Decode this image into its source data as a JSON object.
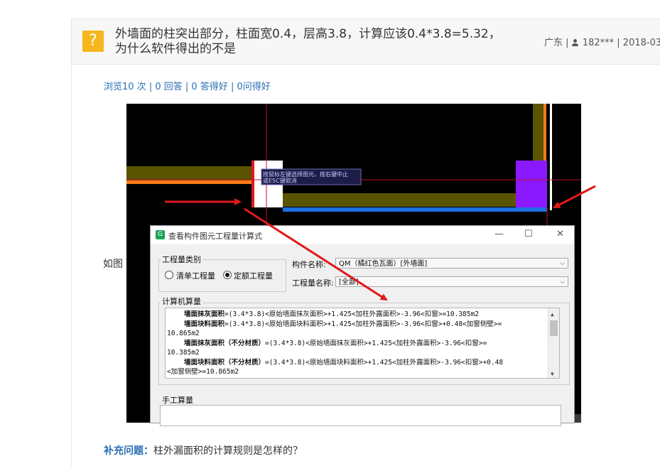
{
  "question": {
    "icon": "question-mark-icon",
    "title_line1": "外墙面的柱突出部分，柱面宽0.4，层高3.8，计算应该0.4*3.8=5.32，",
    "title_line2": "为什么软件得出的不是",
    "region": "广东",
    "user": "182***",
    "date": "2018-03"
  },
  "stats": {
    "views": "浏览10 次",
    "answers": "0 回答",
    "good_answers": "0 答得好",
    "asks": "0问得好"
  },
  "body_prefix": "如图",
  "cad": {
    "tooltip_line1": "按鼠标左键选择图元，按右键中止",
    "tooltip_line2": "或ESC键取消"
  },
  "dialog": {
    "title": "查看构件图元工程量计算式",
    "controls": [
      "—",
      "☐",
      "✕"
    ],
    "quantity_type_label": "工程量类别",
    "radio_list": "清单工程量",
    "radio_quota": "定额工程量",
    "selected_radio": "定额工程量",
    "component_name_label": "构件名称:",
    "component_name_value": "QM（橘红色瓦面）[外墙面]",
    "quantity_name_label": "工程量名称:",
    "quantity_name_value": "[全部]",
    "computer_calc_label": "计算机算量",
    "calc_lines": [
      {
        "bold": "墙面抹灰面积",
        "rest": "=(3.4*3.8)<原始墙面抹灰面积>+1.425<加柱外露面积>-3.96<扣窗>=10.385m2"
      },
      {
        "bold": "墙面块料面积",
        "rest": "=(3.4*3.8)<原始墙面块料面积>+1.425<加柱外露面积>-3.96<扣窗>+0.48<加窗侧壁>="
      },
      {
        "bold": "",
        "rest": "10.865m2"
      },
      {
        "bold": "墙面抹灰面积（不分材质）",
        "rest": "=(3.4*3.8)<原始墙面抹灰面积>+1.425<加柱外露面积>-3.96<扣窗>="
      },
      {
        "bold": "",
        "rest": "10.385m2"
      },
      {
        "bold": "墙面块料面积（不分材质）",
        "rest": "=(3.4*3.8)<原始墙面块料面积>+1.425<加柱外露面积>-3.96<扣窗>+0.48"
      },
      {
        "bold": "",
        "rest": "<加窗侧壁>=10.865m2"
      }
    ],
    "manual_calc_label": "手工算量"
  },
  "supplement": {
    "label": "补充问题：",
    "text": "柱外漏面积的计算规则是怎样的？"
  },
  "colors": {
    "accent_blue": "#2a6fb5",
    "question_icon": "#f5b61e",
    "annotation_arrow": "#e0191b",
    "wall_olive": "#5a5400",
    "wall_orange": "#ff7a1a",
    "wall_blue": "#1e6fe0",
    "column_purple": "#8a19ff"
  }
}
